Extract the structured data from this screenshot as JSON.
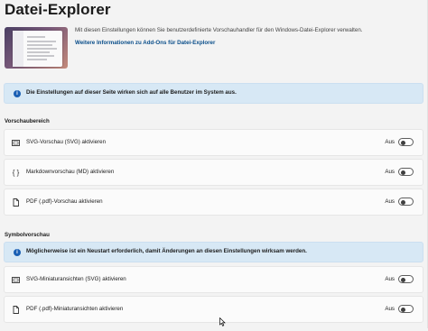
{
  "page": {
    "title": "Datei-Explorer"
  },
  "hero": {
    "description": "Mit diesen Einstellungen können Sie benutzerdefinierte Vorschauhandler für den Windows-Datei-Explorer verwalten.",
    "link": "Weitere Informationen zu Add-Ons für Datei-Explorer"
  },
  "info": {
    "text": "Die Einstellungen auf dieser Seite wirken sich auf alle Benutzer im System aus."
  },
  "preview_section": {
    "title": "Vorschaubereich",
    "items": [
      {
        "icon": "svg-file-icon",
        "label": "SVG-Vorschau (SVG) aktivieren",
        "state": "Aus"
      },
      {
        "icon": "code-braces-icon",
        "label": "Markdownvorschau (MD) aktivieren",
        "state": "Aus"
      },
      {
        "icon": "pdf-file-icon",
        "label": "PDF (.pdf)-Vorschau aktivieren",
        "state": "Aus"
      }
    ]
  },
  "thumbnail_section": {
    "title": "Symbolvorschau",
    "warning": "Möglicherweise ist ein Neustart erforderlich, damit Änderungen an diesen Einstellungen wirksam werden.",
    "items": [
      {
        "icon": "svg-file-icon",
        "label": "SVG-Miniaturansichten (SVG) aktivieren",
        "state": "Aus"
      },
      {
        "icon": "pdf-file-icon",
        "label": "PDF (.pdf)-Miniaturansichten aktivieren",
        "state": "Aus"
      }
    ]
  },
  "colors": {
    "background": "#f3f3f3",
    "info_bar": "#d7e8f5",
    "info_icon": "#1a5fb4",
    "link": "#0a4e8a"
  }
}
